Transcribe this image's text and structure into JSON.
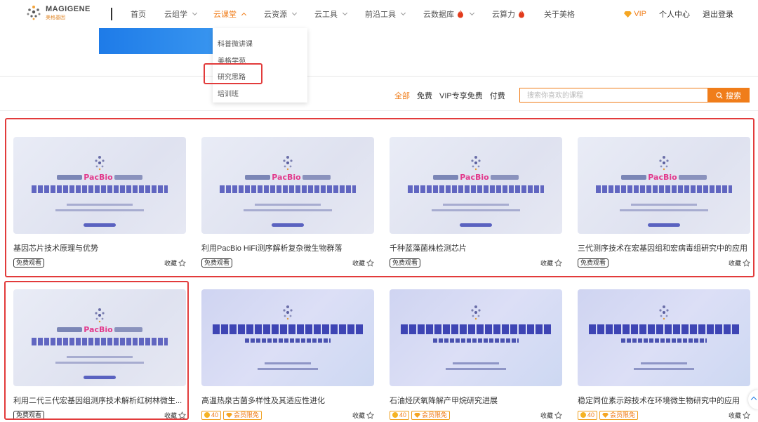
{
  "header": {
    "brand_name": "MAGIGENE",
    "brand_sub": "美格基因",
    "nav": [
      {
        "label": "首页",
        "caret": false
      },
      {
        "label": "云组学",
        "caret": true
      },
      {
        "label": "云课堂",
        "caret": true,
        "active": true
      },
      {
        "label": "云资源",
        "caret": true
      },
      {
        "label": "云工具",
        "caret": true
      },
      {
        "label": "前沿工具",
        "caret": true
      },
      {
        "label": "云数据库",
        "caret": true,
        "hot": true
      },
      {
        "label": "云算力",
        "caret": false,
        "hot": true
      },
      {
        "label": "关于美格",
        "caret": false
      }
    ],
    "vip": "VIP",
    "account": "个人中心",
    "logout": "退出登录"
  },
  "dropdown": {
    "items": [
      "科普微讲课",
      "美格学苑",
      "研究思路",
      "培训班"
    ],
    "highlighted_index": 2
  },
  "filters": {
    "items": [
      "全部",
      "免费",
      "VIP专享免费",
      "付费"
    ],
    "active_index": 0
  },
  "search": {
    "placeholder": "搜索你喜欢的课程",
    "button": "搜索"
  },
  "cards": [
    {
      "title": "基因芯片技术原理与优势",
      "badge": "免费观看",
      "fav": "收藏",
      "style": "a"
    },
    {
      "title": "利用PacBio HiFi测序解析复杂微生物群落",
      "badge": "免费观看",
      "fav": "收藏",
      "style": "a"
    },
    {
      "title": "千种蓝藻菌株检测芯片",
      "badge": "免费观看",
      "fav": "收藏",
      "style": "a"
    },
    {
      "title": "三代测序技术在宏基因组和宏病毒组研究中的应用",
      "badge": "免费观看",
      "fav": "收藏",
      "style": "a"
    },
    {
      "title": "利用二代三代宏基因组测序技术解析红树林微生...",
      "badge": "免费观看",
      "fav": "收藏",
      "style": "a"
    },
    {
      "title": "高温热泉古菌多样性及其适应性进化",
      "coins": "40",
      "member": "会员限免",
      "fav": "收藏",
      "style": "b"
    },
    {
      "title": "石油烃厌氧降解产甲烷研究进展",
      "coins": "40",
      "member": "会员限免",
      "fav": "收藏",
      "style": "b"
    },
    {
      "title": "稳定同位素示踪技术在环境微生物研究中的应用",
      "coins": "40",
      "member": "会员限免",
      "fav": "收藏",
      "style": "b"
    }
  ],
  "thumb_a": {
    "brand": "PacBio"
  },
  "colors": {
    "accent": "#f07d1a",
    "highlight": "#e23b3b",
    "banner": "#1e7be8"
  }
}
